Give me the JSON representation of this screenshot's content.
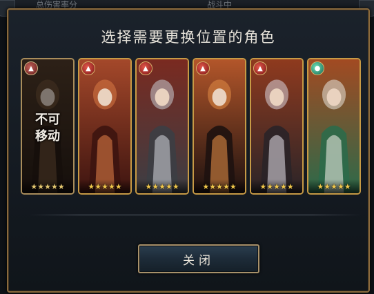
{
  "background": {
    "top_text_left": "总伤害率分",
    "top_text_mid": "战斗中"
  },
  "dialog": {
    "title": "选择需要更换位置的角色",
    "close_label": "关闭"
  },
  "cards": [
    {
      "id": "char-1",
      "element": "fire",
      "element_icon": "flame-icon",
      "stars": 5,
      "locked": true,
      "lock_text": "不可\n移动",
      "palette": [
        "#5a3a22",
        "#2b1a12",
        "#8a5a30"
      ]
    },
    {
      "id": "char-2",
      "element": "fire",
      "element_icon": "flame-icon",
      "stars": 5,
      "locked": false,
      "palette": [
        "#a4482a",
        "#3d1410",
        "#d97a45"
      ]
    },
    {
      "id": "char-3",
      "element": "fire",
      "element_icon": "flame-icon",
      "stars": 5,
      "locked": false,
      "palette": [
        "#7a2a20",
        "#3c3e44",
        "#c9ccd2"
      ]
    },
    {
      "id": "char-4",
      "element": "fire",
      "element_icon": "flame-icon",
      "stars": 5,
      "locked": false,
      "palette": [
        "#b3562a",
        "#1e1210",
        "#e08a45"
      ]
    },
    {
      "id": "char-5",
      "element": "fire",
      "element_icon": "flame-icon",
      "stars": 5,
      "locked": false,
      "palette": [
        "#8f3a1e",
        "#2a2428",
        "#d8d4dc"
      ]
    },
    {
      "id": "char-6",
      "element": "wind",
      "element_icon": "leaf-icon",
      "stars": 5,
      "locked": false,
      "palette": [
        "#a24a22",
        "#2c6a4a",
        "#e8e6de"
      ]
    }
  ],
  "colors": {
    "frame_gold": "#c79a45",
    "star_gold": "#f2c84b",
    "button_blue": "#1d2b38"
  }
}
